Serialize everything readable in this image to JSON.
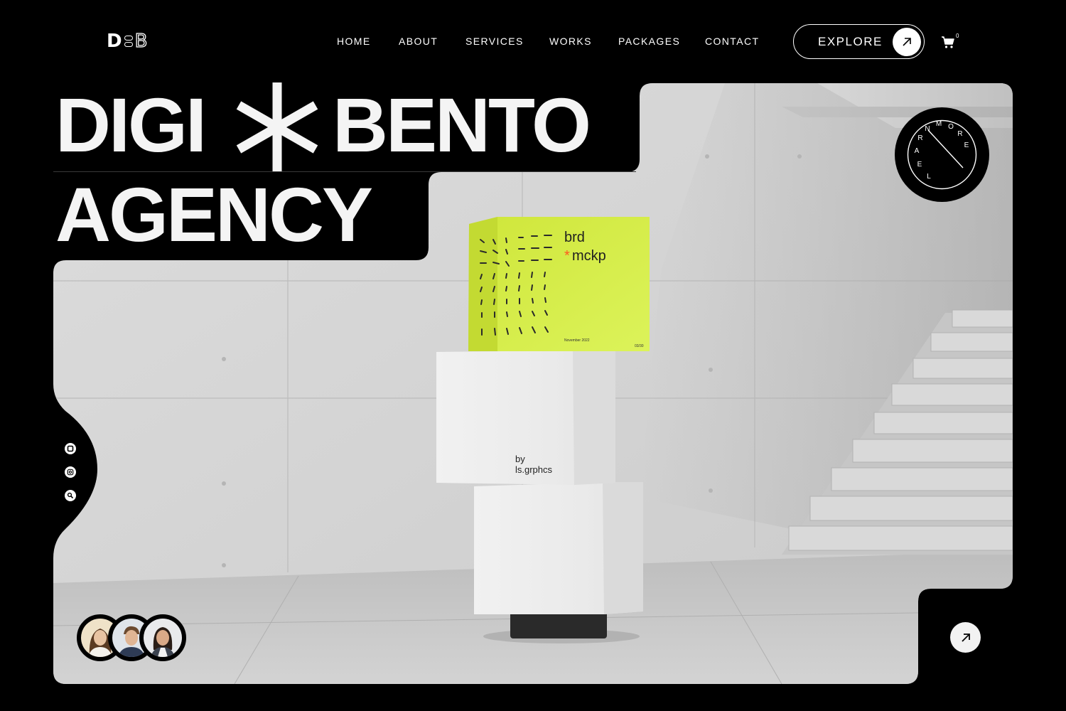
{
  "brand": {
    "logo_left": "D",
    "logo_right": "B"
  },
  "nav": {
    "home": "HOME",
    "about": "ABOUT",
    "services": "SERVICES",
    "works": "WORKS",
    "packages": "PACKAGES",
    "contact": "CONTACT"
  },
  "header": {
    "explore_label": "EXPLORE",
    "cart_count": "0"
  },
  "hero": {
    "title_line1_a": "DIGI",
    "title_line1_b": "BENTO",
    "title_line2": "AGENCY",
    "badge_text": "LEARNMORE",
    "box_top_line1": "brd",
    "box_top_line2": "mckp",
    "box_top_date": "November 2022",
    "box_top_code": "03/30",
    "box_mid_line1": "by",
    "box_mid_line2": "ls.grphcs"
  },
  "icons": {
    "explore_arrow": "arrow-up-right-icon",
    "cart": "cart-icon",
    "corner_arrow": "arrow-up-right-icon",
    "social": [
      "square-social-icon",
      "instagram-icon",
      "link-icon"
    ]
  },
  "colors": {
    "background": "#000000",
    "accent": "#d8f14a",
    "asterisk": "#ff5a1f"
  }
}
